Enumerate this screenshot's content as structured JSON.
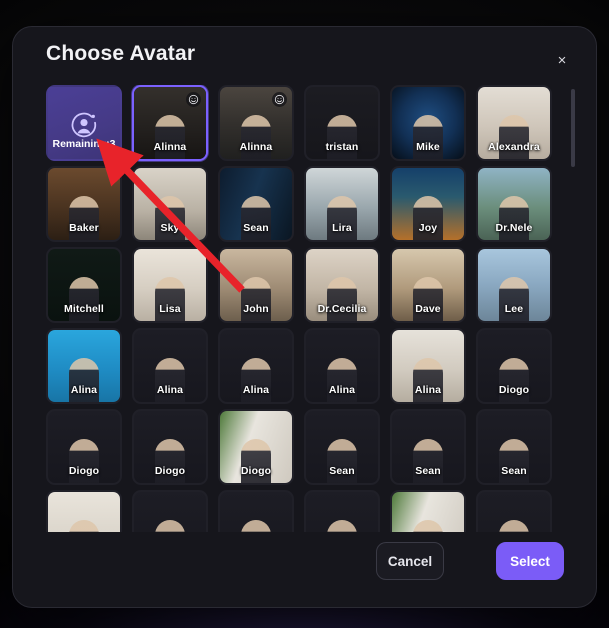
{
  "modal": {
    "title": "Choose Avatar",
    "close_label": "×"
  },
  "remaining_tile": {
    "label": "Remaining:3",
    "icon": "add-user-icon"
  },
  "footer": {
    "cancel_label": "Cancel",
    "select_label": "Select"
  },
  "colors": {
    "accent": "#7b5cf7",
    "selected_border": "#7b61ff",
    "modal_bg": "#16161c",
    "remaining_bg": "#453a86",
    "arrow": "#e8232a"
  },
  "avatars": [
    {
      "label": "Alinna",
      "badge": "smiley-icon",
      "selected": true,
      "art": "kitchen-dark-blonde"
    },
    {
      "label": "Alinna",
      "badge": "smiley-icon",
      "selected": false,
      "art": "kitchen-sofa-blonde"
    },
    {
      "label": "tristan",
      "badge": null,
      "selected": false,
      "art": "dark-plaid-jacket"
    },
    {
      "label": "Mike",
      "badge": null,
      "selected": false,
      "art": "blue-tech-glow"
    },
    {
      "label": "Alexandra",
      "badge": null,
      "selected": false,
      "art": "bright-room-dog"
    },
    {
      "label": "Baker",
      "badge": null,
      "selected": false,
      "art": "office-leather-sofa"
    },
    {
      "label": "Sky",
      "badge": null,
      "selected": false,
      "art": "modern-loft"
    },
    {
      "label": "Sean",
      "badge": null,
      "selected": false,
      "art": "breaking-news-studio"
    },
    {
      "label": "Lira",
      "badge": null,
      "selected": false,
      "art": "server-room"
    },
    {
      "label": "Joy",
      "badge": null,
      "selected": false,
      "art": "lanterns-night"
    },
    {
      "label": "Dr.Nele",
      "badge": null,
      "selected": false,
      "art": "mountain-terrace"
    },
    {
      "label": "Mitchell",
      "badge": null,
      "selected": false,
      "art": "code-screen"
    },
    {
      "label": "Lisa",
      "badge": null,
      "selected": false,
      "art": "white-kitchen"
    },
    {
      "label": "John",
      "badge": null,
      "selected": false,
      "art": "warm-interior"
    },
    {
      "label": "Dr.Cecilia",
      "badge": null,
      "selected": false,
      "art": "bedroom-beige"
    },
    {
      "label": "Dave",
      "badge": null,
      "selected": false,
      "art": "classic-hall"
    },
    {
      "label": "Lee",
      "badge": null,
      "selected": false,
      "art": "louvre-pyramid"
    },
    {
      "label": "Alina",
      "badge": null,
      "selected": false,
      "art": "weather-forecast"
    },
    {
      "label": "Alina",
      "badge": null,
      "selected": false,
      "art": "dark-studio"
    },
    {
      "label": "Alina",
      "badge": null,
      "selected": false,
      "art": "dark-studio"
    },
    {
      "label": "Alina",
      "badge": null,
      "selected": false,
      "art": "dark-studio"
    },
    {
      "label": "Alina",
      "badge": null,
      "selected": false,
      "art": "living-room-laptop"
    },
    {
      "label": "Diogo",
      "badge": null,
      "selected": false,
      "art": "dark-studio"
    },
    {
      "label": "Diogo",
      "badge": null,
      "selected": false,
      "art": "dark-studio"
    },
    {
      "label": "Diogo",
      "badge": null,
      "selected": false,
      "art": "dark-studio"
    },
    {
      "label": "Diogo",
      "badge": null,
      "selected": false,
      "art": "garden-window"
    },
    {
      "label": "Sean",
      "badge": null,
      "selected": false,
      "art": "dark-studio"
    },
    {
      "label": "Sean",
      "badge": null,
      "selected": false,
      "art": "dark-studio"
    },
    {
      "label": "Sean",
      "badge": null,
      "selected": false,
      "art": "dark-studio"
    },
    {
      "label": "",
      "badge": null,
      "selected": false,
      "art": "bright-room-partial"
    },
    {
      "label": "",
      "badge": null,
      "selected": false,
      "art": "dark-studio"
    },
    {
      "label": "",
      "badge": null,
      "selected": false,
      "art": "dark-studio"
    },
    {
      "label": "",
      "badge": null,
      "selected": false,
      "art": "dark-studio"
    },
    {
      "label": "",
      "badge": null,
      "selected": false,
      "art": "garden-window"
    },
    {
      "label": "",
      "badge": null,
      "selected": false,
      "art": "dark-studio"
    }
  ]
}
